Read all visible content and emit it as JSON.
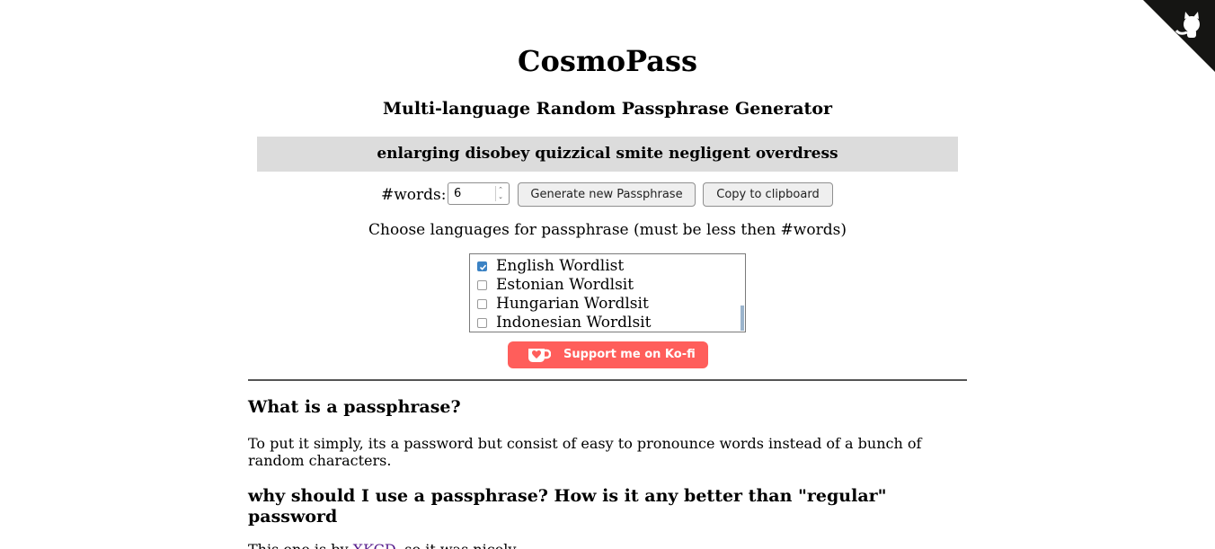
{
  "header": {
    "title": "CosmoPass",
    "subtitle": "Multi-language Random Passphrase Generator"
  },
  "passphrase": "enlarging disobey quizzical smite negligent overdress",
  "controls": {
    "words_label": "#words:",
    "words_value": "6",
    "generate_label": "Generate new Passphrase",
    "copy_label": "Copy to clipboard"
  },
  "languages": {
    "prompt": "Choose languages for passphrase (must be less then #words)",
    "items": [
      {
        "label": "English Wordlist",
        "checked": true
      },
      {
        "label": "Estonian Wordlsit",
        "checked": false
      },
      {
        "label": "Hungarian Wordlsit",
        "checked": false
      },
      {
        "label": "Indonesian Wordlsit",
        "checked": false
      }
    ]
  },
  "kofi": {
    "label": "Support me on Ko-fi",
    "color": "#ff5e5b"
  },
  "faq": {
    "q1": "What is a passphrase?",
    "a1": "To put it simply, its a password but consist of easy to pronounce words instead of a bunch of random characters.",
    "q2": "why should I use a passphrase? How is it any better than \"regular\" password",
    "a2_prefix": "This one is by",
    "a2_link": "XKCD",
    "a2_suffix": ", so it was nicely"
  },
  "icons": {
    "corner": "github-octocat-icon",
    "kofi": "kofi-cup-icon"
  }
}
